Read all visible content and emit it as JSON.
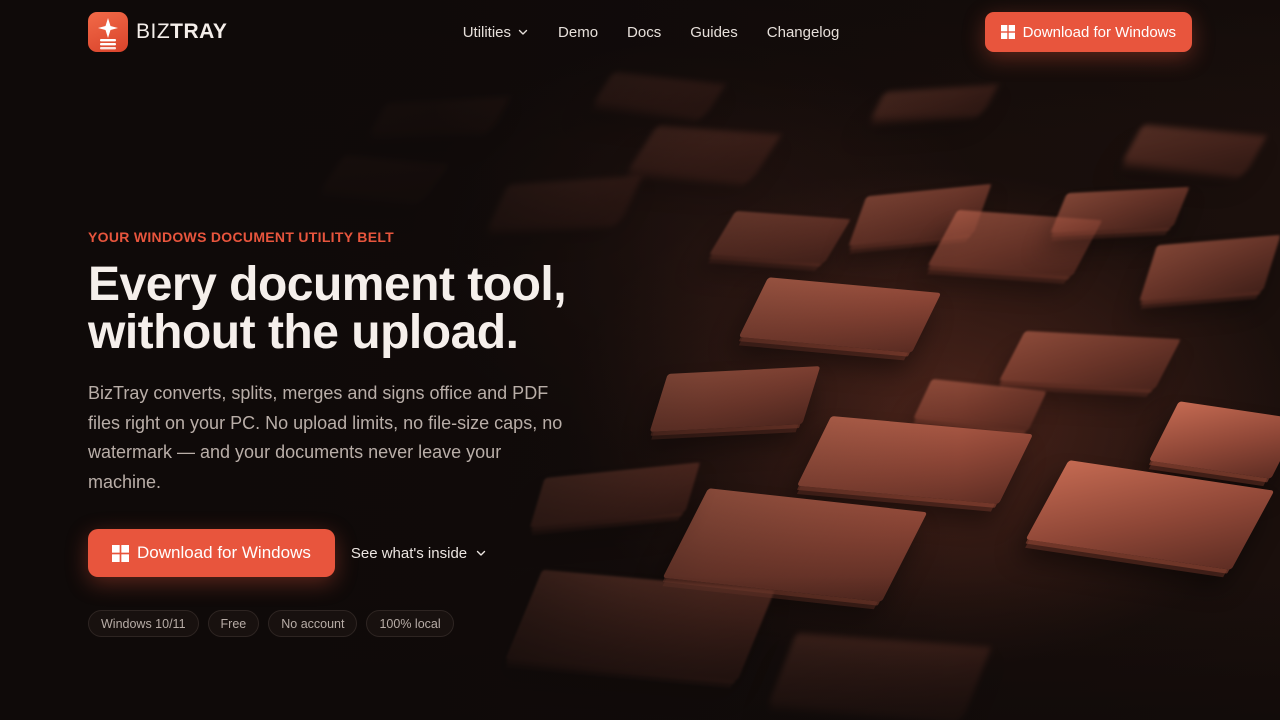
{
  "brand": {
    "name_light": "BIZ",
    "name_bold": "TRAY",
    "accent_color": "#e8553d"
  },
  "nav": {
    "items": [
      {
        "label": "Utilities",
        "has_dropdown": true
      },
      {
        "label": "Demo"
      },
      {
        "label": "Docs"
      },
      {
        "label": "Guides"
      },
      {
        "label": "Changelog"
      }
    ]
  },
  "header": {
    "download_label": "Download for Windows",
    "download_icon": "windows-icon"
  },
  "hero": {
    "eyebrow": "YOUR WINDOWS DOCUMENT UTILITY BELT",
    "headline_line1": "Every document tool,",
    "headline_line2": "without the upload.",
    "lead": "BizTray converts, splits, merges and signs office and PDF files right on your PC. No upload limits, no file-size caps, no watermark — and your documents never leave your machine.",
    "cta_primary": "Download for Windows",
    "cta_secondary": "See what's inside",
    "badges": [
      "Windows 10/11",
      "Free",
      "No account",
      "100% local"
    ]
  },
  "colors": {
    "background": "#0f0a09",
    "accent": "#e8553d",
    "text": "#f5efeb",
    "muted": "#b9aea8"
  }
}
